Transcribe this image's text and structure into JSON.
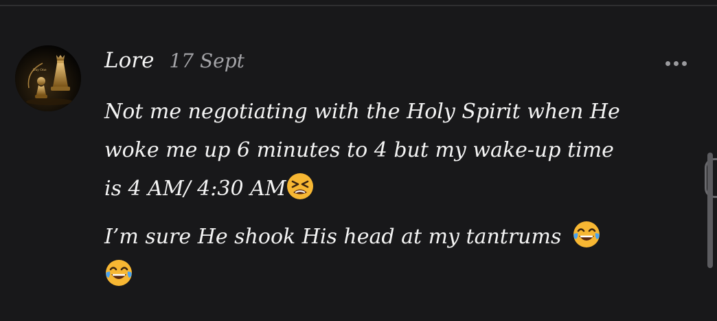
{
  "post": {
    "author": "Lore",
    "date": "17 Sept",
    "avatar_icon": "chess-king-avatar-icon",
    "avatar_inscription": "Day One",
    "more_icon": "more-horizontal-icon",
    "paragraph_1": {
      "line_1": "Not me negotiating with the Holy Spirit when He",
      "line_2": "woke me up 6 minutes to 4 but my wake-up time",
      "line_3": "is 4 AM/ 4:30 AM",
      "trailing_emoji": "tired-face-emoji"
    },
    "paragraph_2": {
      "line_1": "I’m sure He shook His head at my tantrums",
      "emojis": [
        "tears-of-joy-emoji",
        "tears-of-joy-emoji"
      ]
    }
  },
  "colors": {
    "background": "#18181a",
    "text": "#f4f4f4",
    "date_text": "#a4a4a8",
    "emoji_yellow": "#f7b733",
    "tear_blue": "#4aa3f0"
  }
}
